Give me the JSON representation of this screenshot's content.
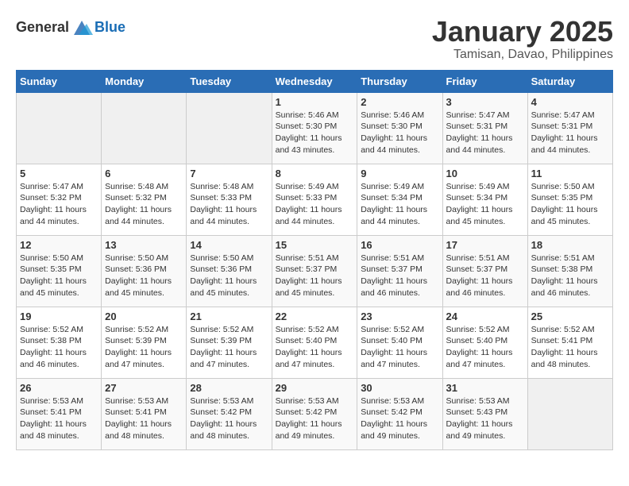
{
  "header": {
    "logo_general": "General",
    "logo_blue": "Blue",
    "month": "January 2025",
    "location": "Tamisan, Davao, Philippines"
  },
  "days_of_week": [
    "Sunday",
    "Monday",
    "Tuesday",
    "Wednesday",
    "Thursday",
    "Friday",
    "Saturday"
  ],
  "weeks": [
    [
      {
        "day": "",
        "info": ""
      },
      {
        "day": "",
        "info": ""
      },
      {
        "day": "",
        "info": ""
      },
      {
        "day": "1",
        "info": "Sunrise: 5:46 AM\nSunset: 5:30 PM\nDaylight: 11 hours\nand 43 minutes."
      },
      {
        "day": "2",
        "info": "Sunrise: 5:46 AM\nSunset: 5:30 PM\nDaylight: 11 hours\nand 44 minutes."
      },
      {
        "day": "3",
        "info": "Sunrise: 5:47 AM\nSunset: 5:31 PM\nDaylight: 11 hours\nand 44 minutes."
      },
      {
        "day": "4",
        "info": "Sunrise: 5:47 AM\nSunset: 5:31 PM\nDaylight: 11 hours\nand 44 minutes."
      }
    ],
    [
      {
        "day": "5",
        "info": "Sunrise: 5:47 AM\nSunset: 5:32 PM\nDaylight: 11 hours\nand 44 minutes."
      },
      {
        "day": "6",
        "info": "Sunrise: 5:48 AM\nSunset: 5:32 PM\nDaylight: 11 hours\nand 44 minutes."
      },
      {
        "day": "7",
        "info": "Sunrise: 5:48 AM\nSunset: 5:33 PM\nDaylight: 11 hours\nand 44 minutes."
      },
      {
        "day": "8",
        "info": "Sunrise: 5:49 AM\nSunset: 5:33 PM\nDaylight: 11 hours\nand 44 minutes."
      },
      {
        "day": "9",
        "info": "Sunrise: 5:49 AM\nSunset: 5:34 PM\nDaylight: 11 hours\nand 44 minutes."
      },
      {
        "day": "10",
        "info": "Sunrise: 5:49 AM\nSunset: 5:34 PM\nDaylight: 11 hours\nand 45 minutes."
      },
      {
        "day": "11",
        "info": "Sunrise: 5:50 AM\nSunset: 5:35 PM\nDaylight: 11 hours\nand 45 minutes."
      }
    ],
    [
      {
        "day": "12",
        "info": "Sunrise: 5:50 AM\nSunset: 5:35 PM\nDaylight: 11 hours\nand 45 minutes."
      },
      {
        "day": "13",
        "info": "Sunrise: 5:50 AM\nSunset: 5:36 PM\nDaylight: 11 hours\nand 45 minutes."
      },
      {
        "day": "14",
        "info": "Sunrise: 5:50 AM\nSunset: 5:36 PM\nDaylight: 11 hours\nand 45 minutes."
      },
      {
        "day": "15",
        "info": "Sunrise: 5:51 AM\nSunset: 5:37 PM\nDaylight: 11 hours\nand 45 minutes."
      },
      {
        "day": "16",
        "info": "Sunrise: 5:51 AM\nSunset: 5:37 PM\nDaylight: 11 hours\nand 46 minutes."
      },
      {
        "day": "17",
        "info": "Sunrise: 5:51 AM\nSunset: 5:37 PM\nDaylight: 11 hours\nand 46 minutes."
      },
      {
        "day": "18",
        "info": "Sunrise: 5:51 AM\nSunset: 5:38 PM\nDaylight: 11 hours\nand 46 minutes."
      }
    ],
    [
      {
        "day": "19",
        "info": "Sunrise: 5:52 AM\nSunset: 5:38 PM\nDaylight: 11 hours\nand 46 minutes."
      },
      {
        "day": "20",
        "info": "Sunrise: 5:52 AM\nSunset: 5:39 PM\nDaylight: 11 hours\nand 47 minutes."
      },
      {
        "day": "21",
        "info": "Sunrise: 5:52 AM\nSunset: 5:39 PM\nDaylight: 11 hours\nand 47 minutes."
      },
      {
        "day": "22",
        "info": "Sunrise: 5:52 AM\nSunset: 5:40 PM\nDaylight: 11 hours\nand 47 minutes."
      },
      {
        "day": "23",
        "info": "Sunrise: 5:52 AM\nSunset: 5:40 PM\nDaylight: 11 hours\nand 47 minutes."
      },
      {
        "day": "24",
        "info": "Sunrise: 5:52 AM\nSunset: 5:40 PM\nDaylight: 11 hours\nand 47 minutes."
      },
      {
        "day": "25",
        "info": "Sunrise: 5:52 AM\nSunset: 5:41 PM\nDaylight: 11 hours\nand 48 minutes."
      }
    ],
    [
      {
        "day": "26",
        "info": "Sunrise: 5:53 AM\nSunset: 5:41 PM\nDaylight: 11 hours\nand 48 minutes."
      },
      {
        "day": "27",
        "info": "Sunrise: 5:53 AM\nSunset: 5:41 PM\nDaylight: 11 hours\nand 48 minutes."
      },
      {
        "day": "28",
        "info": "Sunrise: 5:53 AM\nSunset: 5:42 PM\nDaylight: 11 hours\nand 48 minutes."
      },
      {
        "day": "29",
        "info": "Sunrise: 5:53 AM\nSunset: 5:42 PM\nDaylight: 11 hours\nand 49 minutes."
      },
      {
        "day": "30",
        "info": "Sunrise: 5:53 AM\nSunset: 5:42 PM\nDaylight: 11 hours\nand 49 minutes."
      },
      {
        "day": "31",
        "info": "Sunrise: 5:53 AM\nSunset: 5:43 PM\nDaylight: 11 hours\nand 49 minutes."
      },
      {
        "day": "",
        "info": ""
      }
    ]
  ]
}
